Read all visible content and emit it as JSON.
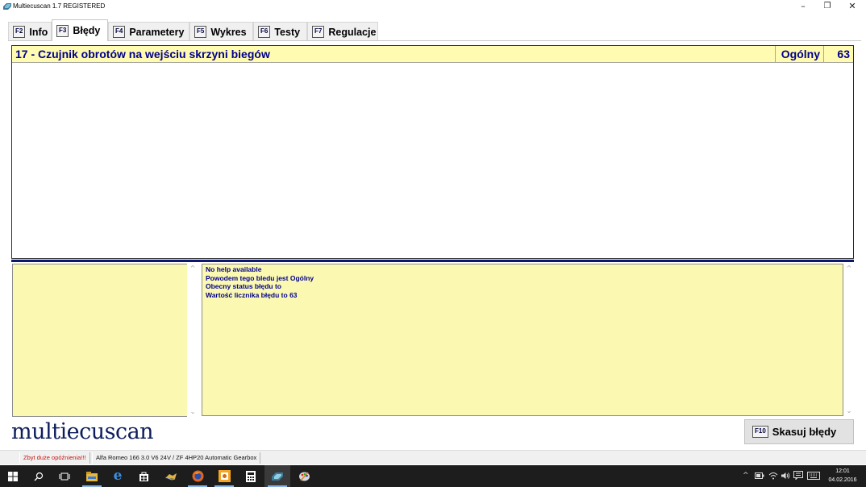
{
  "window": {
    "title": "Multiecuscan 1.7 REGISTERED",
    "minimize_glyph": "–",
    "restore_glyph": "❐",
    "close_glyph": "✕"
  },
  "tabs": [
    {
      "key": "F2",
      "label": "Info",
      "active": false
    },
    {
      "key": "F3",
      "label": "Błędy",
      "active": true
    },
    {
      "key": "F4",
      "label": "Parametery",
      "active": false
    },
    {
      "key": "F5",
      "label": "Wykres",
      "active": false
    },
    {
      "key": "F6",
      "label": "Testy",
      "active": false
    },
    {
      "key": "F7",
      "label": "Regulacje",
      "active": false
    }
  ],
  "errors": [
    {
      "title": "17 - Czujnik obrotów na wejściu skrzyni biegów",
      "type": "Ogólny",
      "count": "63"
    }
  ],
  "help_lines": [
    "No help available",
    "Powodem tego bledu jest Ogólny",
    "Obecny status błędu to",
    "Wartość licznika błędu to 63"
  ],
  "logo_text": "multiecuscan",
  "clear_button": {
    "key": "F10",
    "label": "Skasuj błędy"
  },
  "status": {
    "warning": "Zbyt duże opóźnienia!!!",
    "vehicle": "Alfa Romeo 166 3.0 V6 24V / ZF 4HP20 Automatic Gearbox"
  },
  "taskbar": {
    "time": "12:01",
    "date": "04.02.2016",
    "tray_chevron": "^"
  },
  "colors": {
    "error_row_bg": "#fffbb0",
    "error_text": "#00008b",
    "pane_bg": "#fbf8b2",
    "separator": "#0e1770",
    "logo": "#0d1d5c",
    "warning_text": "#c81414"
  }
}
